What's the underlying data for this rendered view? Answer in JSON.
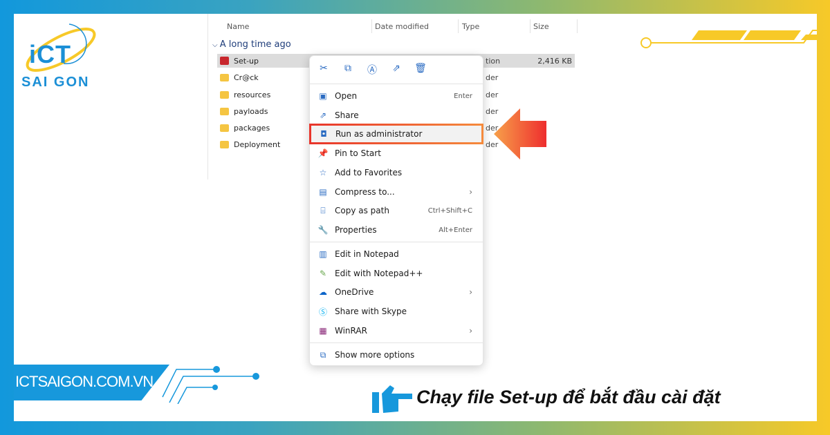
{
  "brand": {
    "logo_top": "iCT",
    "logo_bottom": "SAI GON",
    "website": "ICTSAIGON.COM.VN",
    "accent": "#1798dc",
    "secondary": "#f7c928"
  },
  "explorer": {
    "columns": [
      "Name",
      "Date modified",
      "Type",
      "Size"
    ],
    "group": "A long time ago",
    "rows": [
      {
        "name": "Set-up",
        "type": "tion",
        "size": "2,416 KB",
        "icon": "app-icon"
      },
      {
        "name": "Cr@ck",
        "type": "der",
        "size": "",
        "icon": "folder-icon"
      },
      {
        "name": "resources",
        "type": "der",
        "size": "",
        "icon": "folder-icon"
      },
      {
        "name": "payloads",
        "type": "der",
        "size": "",
        "icon": "folder-icon"
      },
      {
        "name": "packages",
        "type": "der",
        "size": "",
        "icon": "folder-icon"
      },
      {
        "name": "Deployment",
        "type": "der",
        "size": "",
        "icon": "folder-icon"
      }
    ]
  },
  "context_menu": {
    "toolbar": [
      "cut-icon",
      "copy-icon",
      "rename-icon",
      "share-icon",
      "delete-icon"
    ],
    "items": [
      {
        "label": "Open",
        "shortcut": "Enter"
      },
      {
        "label": "Share",
        "shortcut": ""
      },
      {
        "label": "Run as administrator",
        "shortcut": ""
      },
      {
        "label": "Pin to Start",
        "shortcut": ""
      },
      {
        "label": "Add to Favorites",
        "shortcut": ""
      },
      {
        "label": "Compress to...",
        "shortcut": ""
      },
      {
        "label": "Copy as path",
        "shortcut": "Ctrl+Shift+C"
      },
      {
        "label": "Properties",
        "shortcut": "Alt+Enter"
      },
      {
        "label": "Edit in Notepad",
        "shortcut": ""
      },
      {
        "label": "Edit with Notepad++",
        "shortcut": ""
      },
      {
        "label": "OneDrive",
        "shortcut": ""
      },
      {
        "label": "Share with Skype",
        "shortcut": ""
      },
      {
        "label": "WinRAR",
        "shortcut": ""
      },
      {
        "label": "Show more options",
        "shortcut": ""
      }
    ]
  },
  "caption": "Chạy file Set-up để bắt đầu cài đặt"
}
